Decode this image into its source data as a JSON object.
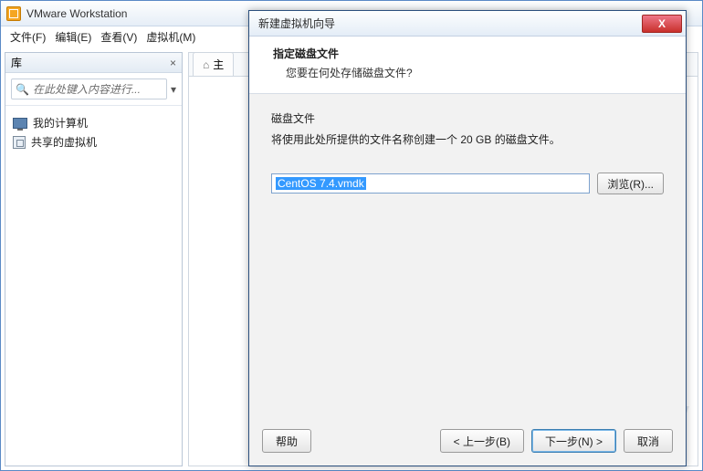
{
  "app": {
    "title": "VMware Workstation"
  },
  "menu": {
    "file": "文件(F)",
    "edit": "编辑(E)",
    "view": "查看(V)",
    "vm": "虚拟机(M)"
  },
  "library": {
    "title": "库",
    "close": "×",
    "search_placeholder": "在此处键入内容进行...",
    "items": [
      {
        "label": "我的计算机"
      },
      {
        "label": "共享的虚拟机"
      }
    ]
  },
  "main_tab": {
    "home_label": "主"
  },
  "watermark": "V",
  "wizard": {
    "title": "新建虚拟机向导",
    "close": "X",
    "heading": "指定磁盘文件",
    "sub": "您要在何处存储磁盘文件?",
    "body_heading": "磁盘文件",
    "body_desc": "将使用此处所提供的文件名称创建一个 20 GB 的磁盘文件。",
    "file_value": "CentOS 7.4.vmdk",
    "browse": "浏览(R)...",
    "footer": {
      "help": "帮助",
      "back": "< 上一步(B)",
      "next": "下一步(N) >",
      "cancel": "取消"
    }
  }
}
